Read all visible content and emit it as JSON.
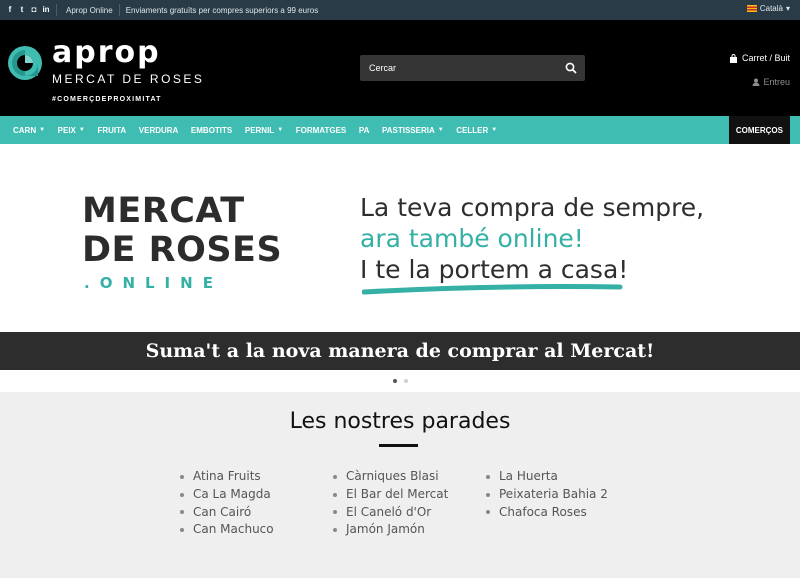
{
  "topbar": {
    "social": [
      {
        "icon": "facebook-icon",
        "glyph": "f"
      },
      {
        "icon": "twitter-icon",
        "glyph": "t"
      },
      {
        "icon": "instagram-icon",
        "glyph": "◘"
      },
      {
        "icon": "linkedin-icon",
        "glyph": "in"
      }
    ],
    "link": "Aprop Online",
    "shipping": "Enviaments gratuïts per compres superiors a 99 euros",
    "language": "Català"
  },
  "header": {
    "logo_title": "aprop",
    "logo_subtitle": "MERCAT DE ROSES",
    "logo_tag": "#COMERÇDEPROXIMITAT",
    "search_placeholder": "Cercar",
    "cart": "Carret / Buit",
    "login": "Entreu"
  },
  "nav": {
    "items": [
      {
        "label": "CARN",
        "dropdown": true
      },
      {
        "label": "PEIX",
        "dropdown": true
      },
      {
        "label": "FRUITA",
        "dropdown": false
      },
      {
        "label": "VERDURA",
        "dropdown": false
      },
      {
        "label": "EMBOTITS",
        "dropdown": false
      },
      {
        "label": "PERNIL",
        "dropdown": true
      },
      {
        "label": "FORMATGES",
        "dropdown": false
      },
      {
        "label": "PA",
        "dropdown": false
      },
      {
        "label": "PASTISSERIA",
        "dropdown": true
      },
      {
        "label": "CELLER",
        "dropdown": true
      }
    ],
    "special": "COMERÇOS"
  },
  "banner": {
    "title_line1": "MERCAT",
    "title_line2": "DE ROSES",
    "title_line3": ".ONLINE",
    "line1": "La teva compra de sempre,",
    "line2": "ara també online!",
    "line3": "I te la portem a casa!",
    "strip": "Suma't a la nova manera de comprar al Mercat!",
    "slides": 2,
    "active_slide": 1
  },
  "stalls": {
    "heading": "Les nostres parades",
    "columns": [
      [
        "Atina Fruits",
        "Ca La Magda",
        "Can Cairó",
        "Can Machuco"
      ],
      [
        "Càrniques Blasi",
        "El Bar del Mercat",
        "El Caneló d'Or",
        "Jamón Jamón"
      ],
      [
        "La Huerta",
        "Peixateria Bahia 2",
        "Chafoca Roses"
      ]
    ]
  },
  "colors": {
    "accent": "#3fbdb2",
    "topbar": "#283b47",
    "header": "#000000",
    "strip": "#2d2d2d"
  }
}
